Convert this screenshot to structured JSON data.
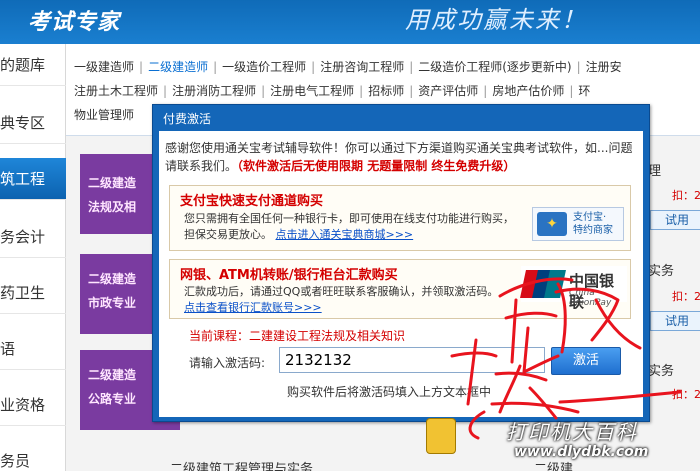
{
  "header": {
    "logo": "考试专家",
    "slogan": "用成功赢未来！"
  },
  "sidebar": {
    "items": [
      {
        "label": "的题库"
      },
      {
        "label": "典专区"
      },
      {
        "label": "筑工程"
      },
      {
        "label": "务会计"
      },
      {
        "label": "药卫生"
      },
      {
        "label": "语"
      },
      {
        "label": "业资格"
      },
      {
        "label": "务员"
      }
    ]
  },
  "nav": {
    "row1": [
      "一级建造师",
      "二级建造师",
      "一级造价工程师",
      "注册咨询工程师",
      "二级造价工程师(逐步更新中)",
      "注册安"
    ],
    "row2": [
      "注册土木工程师",
      "注册消防工程师",
      "注册电气工程师",
      "招标师",
      "资产评估师",
      "房地产估价师",
      "环"
    ],
    "row3": [
      "物业管理师"
    ]
  },
  "content": {
    "cards": [
      {
        "line1": "二级建造",
        "line2": "法规及相"
      },
      {
        "line1": "二级建造",
        "line2": "市政专业"
      },
      {
        "line1": "二级建造",
        "line2": "公路专业"
      }
    ],
    "right_titles": [
      "理",
      "实务",
      "实务"
    ],
    "right_prices": [
      "扣：27.0",
      "扣：27.0",
      "扣：27.0"
    ],
    "try_label": "试用",
    "bottom_titles": [
      "二级建筑工程管理与实务",
      "二级建"
    ]
  },
  "dialog": {
    "title": "付费激活",
    "intro_text": "感谢您使用通关宝考试辅导软件！你可以通过下方渠道购买通关宝典考试软件，如...问题请联系我们。",
    "intro_red": "（软件激活后无使用限期 无题量限制 终生免费升级）",
    "alipay": {
      "title": "支付宝快速支付通道购买",
      "desc": "您只需拥有全国任何一种银行卡，即可使用在线支付功能进行购买，担保交易更放心。",
      "link": "点击进入通关宝典商城>>>",
      "badge_line1": "支付宝·",
      "badge_line2": "特约商家"
    },
    "bank": {
      "title": "网银、ATM机转账/银行柜台汇款购买",
      "desc": "汇款成功后，请通过QQ或者旺旺联系客服确认，并领取激活码。",
      "link": "点击查看银行汇款账号>>>",
      "unionpay_cn": "中国银联",
      "unionpay_en": "China UnionPay"
    },
    "current_course": "当前课程：二建建设工程法规及相关知识",
    "code_label": "请输入激活码:",
    "code_value": "2132132",
    "activate_label": "激活",
    "hint": "购买软件后将激活码填入上方文本框中"
  },
  "watermark": {
    "text": "打印机大百科",
    "url": "www.dlydbk.com"
  },
  "colors": {
    "header_blue": "#0f6bb8",
    "dialog_blue": "#1466b8",
    "highlight_red": "#d40000",
    "link_blue": "#0a50c8",
    "card_purple": "#7a3ba0"
  }
}
